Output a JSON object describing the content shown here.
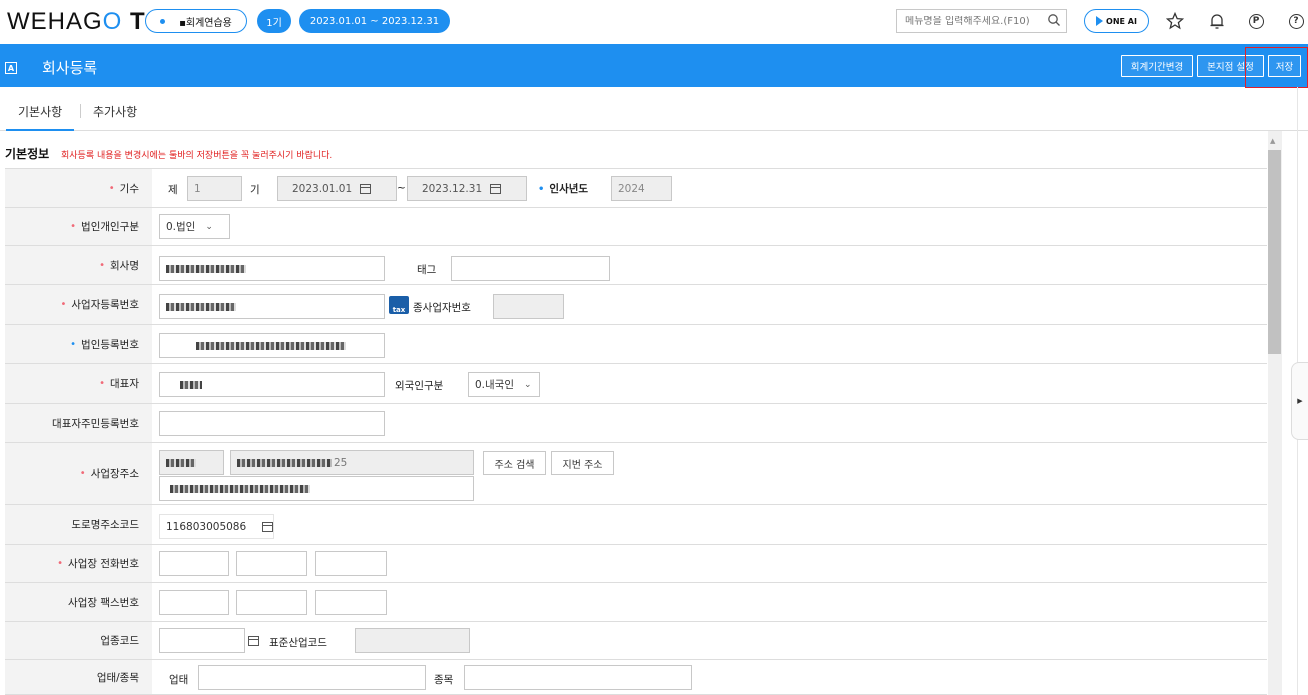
{
  "header": {
    "logo_text": "WEHAGO T",
    "company_name": "▪회계연습용",
    "term": "1기",
    "period": "2023.01.01 ~ 2023.12.31",
    "search_placeholder": "메뉴명을 입력해주세요.(F10)",
    "oneai_label": "ONE AI"
  },
  "titlebar": {
    "badge": "A",
    "title": "회사등록",
    "buttons": [
      "회계기간변경",
      "본지점 설정",
      "저장"
    ]
  },
  "tabs": [
    "기본사항",
    "추가사항"
  ],
  "section": {
    "title": "기본정보",
    "note": "회사등록 내용을 변경시에는 툴바의 저장버튼을 꼭 눌러주시기 바랍니다."
  },
  "form": {
    "fiscal": {
      "label": "기수",
      "prefix": "제",
      "term_value": "1",
      "suffix": "기",
      "start": "2023.01.01",
      "tilde": "~",
      "end": "2023.12.31",
      "hr_year_label": "인사년도",
      "hr_year": "2024"
    },
    "corp_type": {
      "label": "법인개인구분",
      "value": "0.법인"
    },
    "company_name": {
      "label": "회사명",
      "tag_label": "태그"
    },
    "biz_reg_no": {
      "label": "사업자등록번호",
      "sub_label": "종사업자번호",
      "tax_icon": "tax"
    },
    "corp_reg_no": {
      "label": "법인등록번호"
    },
    "ceo": {
      "label": "대표자",
      "foreigner_label": "외국인구분",
      "foreigner_value": "0.내국인"
    },
    "ceo_id": {
      "label": "대표자주민등록번호"
    },
    "address": {
      "label": "사업장주소",
      "addr_suffix": "25",
      "search_btn": "주소 검색",
      "lot_btn": "지번 주소"
    },
    "road_code": {
      "label": "도로명주소코드",
      "value": "116803005086"
    },
    "phone": {
      "label": "사업장 전화번호"
    },
    "fax": {
      "label": "사업장 팩스번호"
    },
    "industry": {
      "label": "업종코드",
      "std_label": "표준산업코드"
    },
    "biz_type": {
      "label": "업태/종목",
      "type_label": "업태",
      "item_label": "종목"
    }
  }
}
